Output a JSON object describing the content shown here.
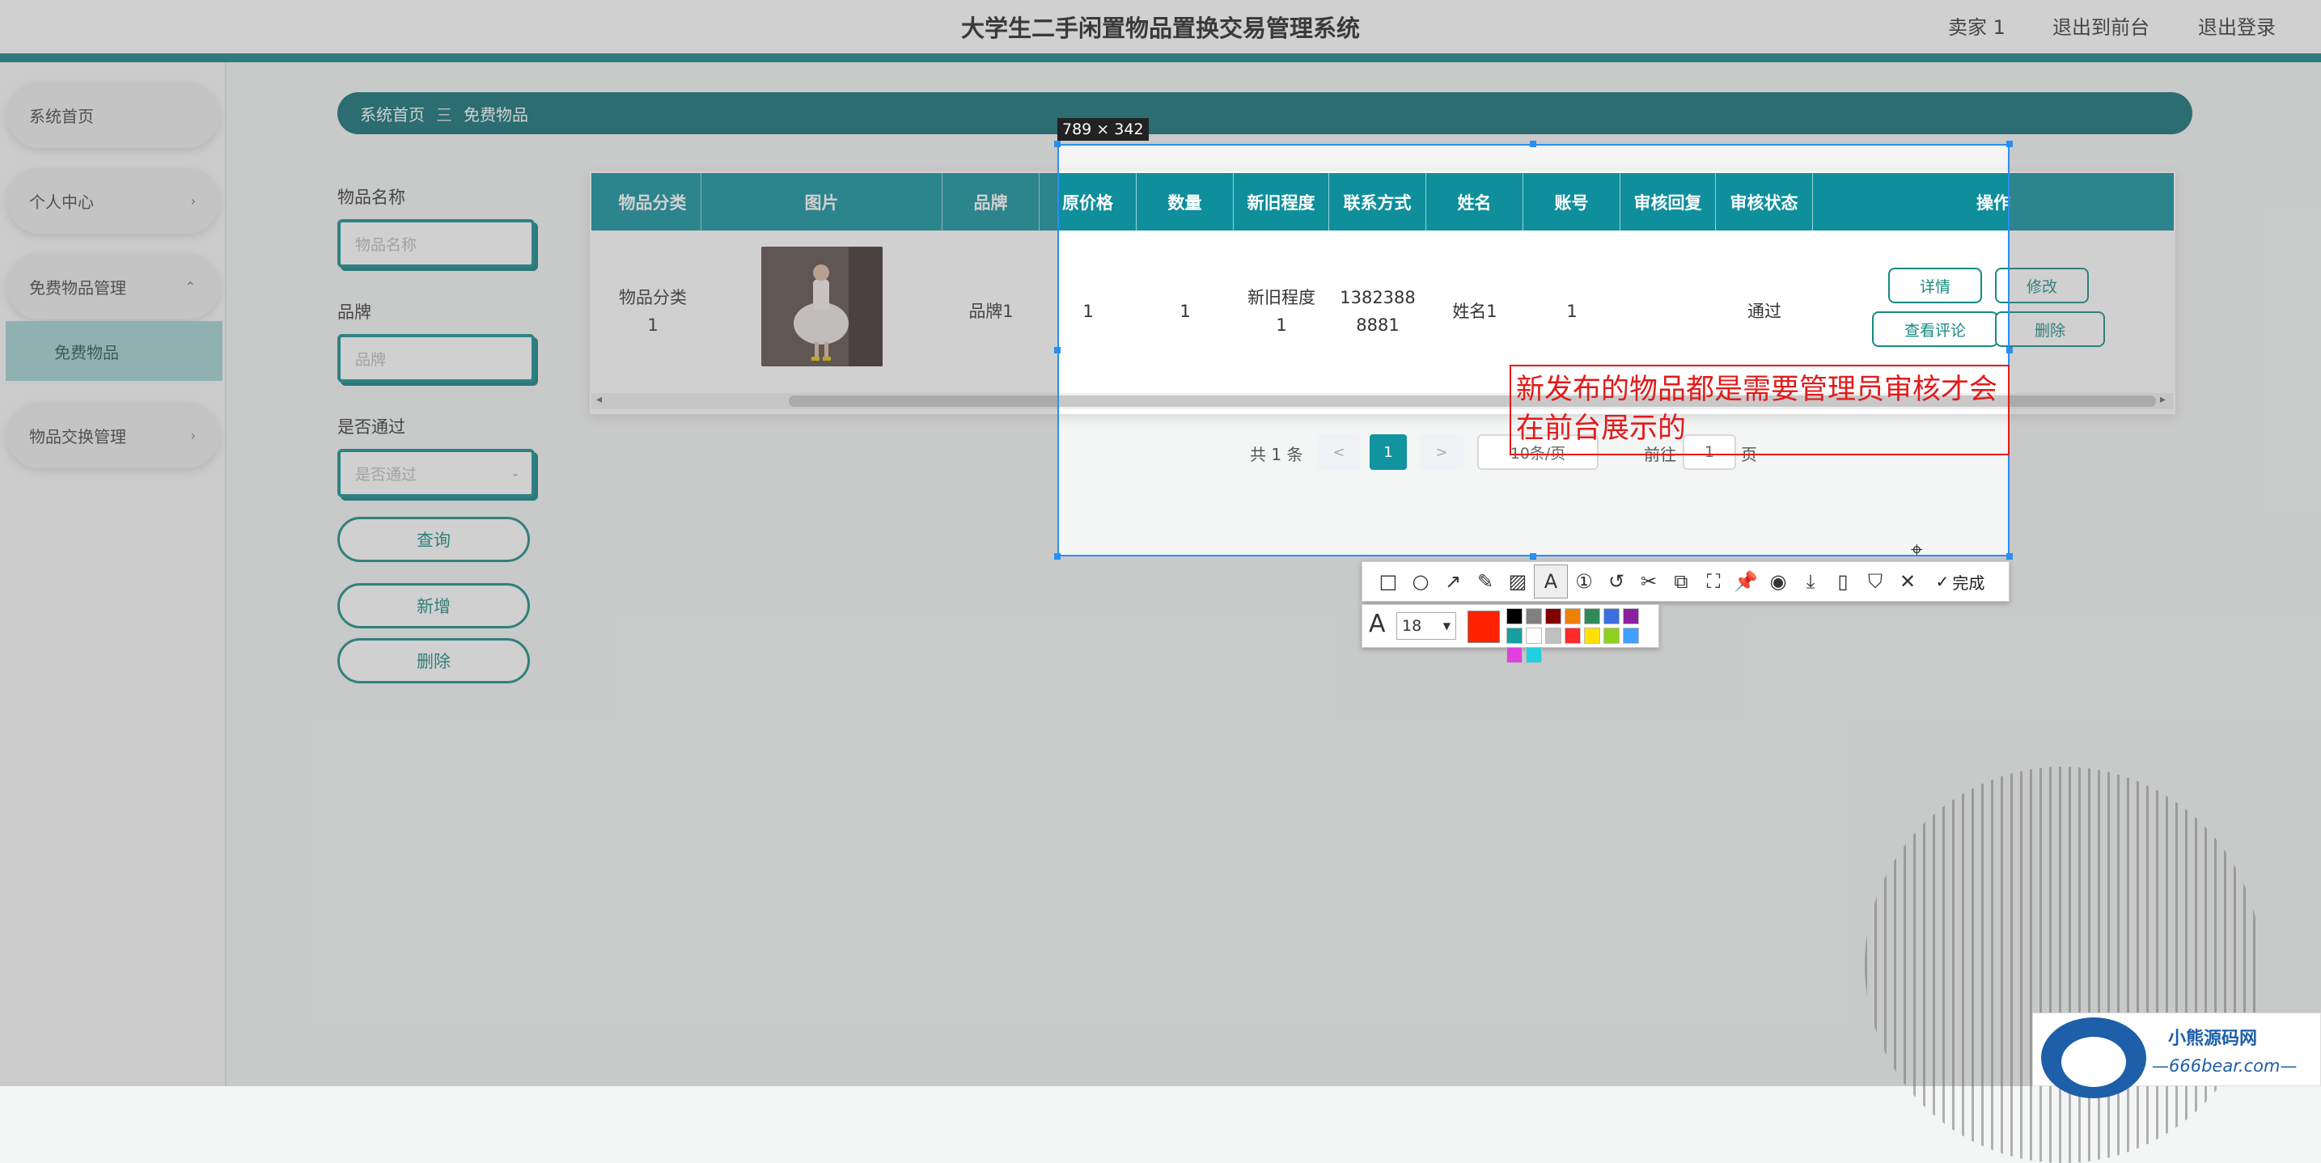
{
  "header": {
    "title": "大学生二手闲置物品置换交易管理系统",
    "user": "卖家 1",
    "front_link": "退出到前台",
    "logout": "退出登录"
  },
  "sidebar": {
    "items": [
      {
        "label": "系统首页"
      },
      {
        "label": "个人中心"
      },
      {
        "label": "免费物品管理"
      },
      {
        "label": "免费物品"
      },
      {
        "label": "物品交换管理"
      }
    ]
  },
  "breadcrumb": {
    "home": "系统首页",
    "separator": "三",
    "current": "免费物品"
  },
  "search": {
    "name_label": "物品名称",
    "name_placeholder": "物品名称",
    "brand_label": "品牌",
    "brand_placeholder": "品牌",
    "pass_label": "是否通过",
    "pass_placeholder": "是否通过",
    "query_button": "查询",
    "add_button": "新增",
    "delete_button": "删除"
  },
  "table": {
    "columns": [
      "物品分类",
      "图片",
      "品牌",
      "原价格",
      "数量",
      "新旧程度",
      "联系方式",
      "姓名",
      "账号",
      "审核回复",
      "审核状态",
      "操作"
    ],
    "row": {
      "category_line1": "物品分类",
      "category_line2": "1",
      "brand": "品牌1",
      "price": "1",
      "qty": "1",
      "cond_line1": "新旧程度",
      "cond_line2": "1",
      "contact_line1": "1382388",
      "contact_line2": "8881",
      "name": "姓名1",
      "account": "1",
      "reply": "",
      "status": "通过",
      "actions": {
        "detail": "详情",
        "edit": "修改",
        "comments": "查看评论",
        "delete": "删除"
      }
    }
  },
  "pagination": {
    "total": "共 1 条",
    "prev": "<",
    "current": "1",
    "next": ">",
    "page_size": "10条/页",
    "goto_label": "前往",
    "goto_value": "1",
    "page_unit": "页"
  },
  "screenshot_tool": {
    "selection_size": "789 × 342",
    "annotation": "新发布的物品都是需要管理员审核才会在前台展示的",
    "font_size": "18",
    "done_label": "完成",
    "active_color": "#ff2200",
    "palette": [
      "#000000",
      "#808080",
      "#800000",
      "#f08000",
      "#2e8b57",
      "#3a6fe0",
      "#8b1fa0",
      "#16a0a0",
      "#ffffff",
      "#c0c0c0",
      "#ff2a2a",
      "#ffe000",
      "#90d020",
      "#3fa0ff",
      "#e040e0",
      "#20d0e0"
    ]
  },
  "watermark": {
    "name": "小熊源码网",
    "url": "—666bear.com—"
  }
}
